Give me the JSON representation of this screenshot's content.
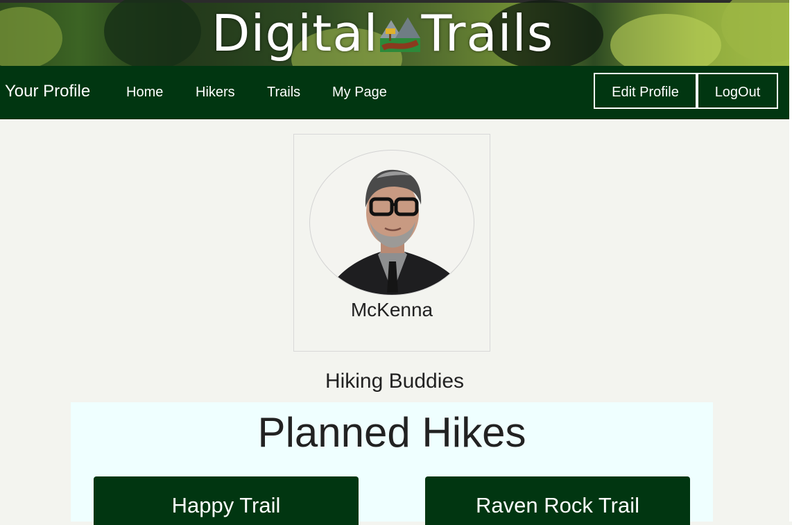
{
  "banner": {
    "title_part1": "Digital",
    "title_part2": "Trails",
    "logo_icon": "mountain-trail-icon"
  },
  "nav": {
    "brand": "Your Profile",
    "links": [
      "Home",
      "Hikers",
      "Trails",
      "My Page"
    ],
    "edit_profile": "Edit Profile",
    "logout": "LogOut"
  },
  "profile": {
    "username": "McKenna",
    "avatar_icon": "profile-photo"
  },
  "buddies": {
    "heading": "Hiking Buddies"
  },
  "planned": {
    "title": "Planned Hikes",
    "hikes": [
      "Happy Trail",
      "Raven Rock Trail"
    ]
  },
  "colors": {
    "nav_bg": "#013611",
    "page_bg": "#f3f4ef",
    "planned_bg": "#efffff",
    "text": "#222222"
  }
}
